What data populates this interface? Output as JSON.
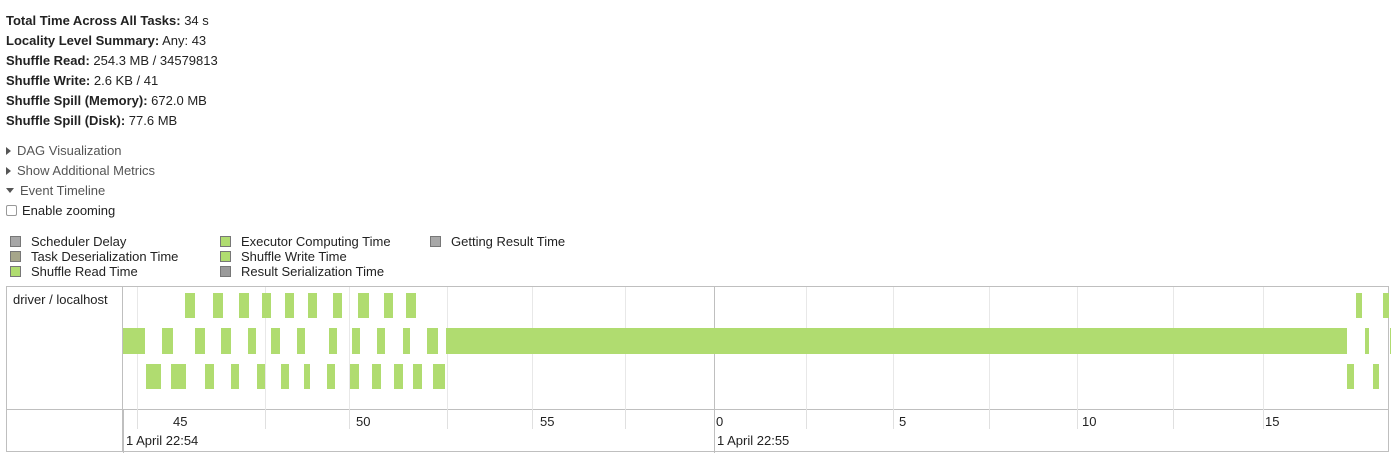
{
  "summary": {
    "total_time": {
      "label": "Total Time Across All Tasks:",
      "value": " 34 s"
    },
    "locality": {
      "label": "Locality Level Summary:",
      "value": " Any: 43"
    },
    "shuffle_read": {
      "label": "Shuffle Read:",
      "value": " 254.3 MB / 34579813"
    },
    "shuffle_write": {
      "label": "Shuffle Write:",
      "value": " 2.6 KB / 41"
    },
    "spill_memory": {
      "label": "Shuffle Spill (Memory):",
      "value": " 672.0 MB"
    },
    "spill_disk": {
      "label": "Shuffle Spill (Disk):",
      "value": " 77.6 MB"
    }
  },
  "toggles": {
    "dag": "DAG Visualization",
    "additional_metrics": "Show Additional Metrics",
    "event_timeline": "Event Timeline"
  },
  "zoom_label": "Enable zooming",
  "legend": {
    "scheduler_delay": {
      "label": "Scheduler Delay",
      "color": "#a7a7a7"
    },
    "task_deser": {
      "label": "Task Deserialization Time",
      "color": "#a6a68a"
    },
    "shuffle_read": {
      "label": "Shuffle Read Time",
      "color": "#b0dc70"
    },
    "executor_compute": {
      "label": "Executor Computing Time",
      "color": "#b0dc70"
    },
    "shuffle_write": {
      "label": "Shuffle Write Time",
      "color": "#b0dc70"
    },
    "result_ser": {
      "label": "Result Serialization Time",
      "color": "#9a9a9a"
    },
    "getting_result": {
      "label": "Getting Result Time",
      "color": "#a8a8a8"
    }
  },
  "timeline": {
    "executor_label": "driver / localhost",
    "ticks": [
      "45",
      "50",
      "55",
      "0",
      "5",
      "10",
      "15"
    ],
    "major_labels": [
      "1 April 22:54",
      "1 April 22:55"
    ],
    "bar_color": "#b0dc70"
  }
}
